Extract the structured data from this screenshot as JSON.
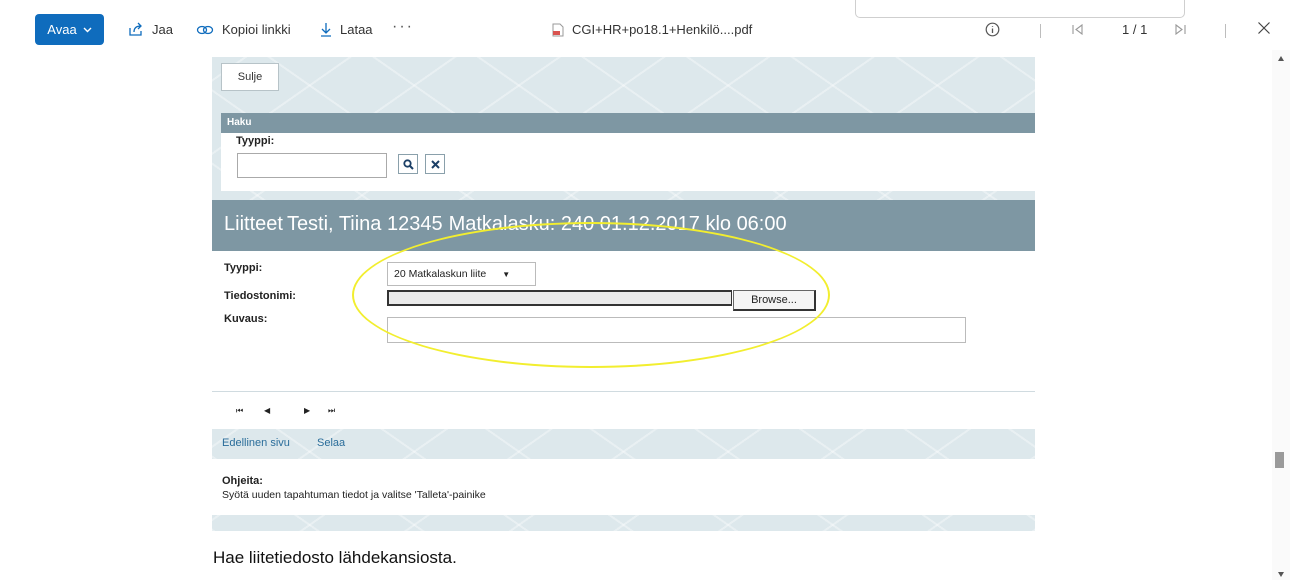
{
  "toolbar": {
    "open_label": "Avaa",
    "share_label": "Jaa",
    "copy_link_label": "Kopioi linkki",
    "download_label": "Lataa",
    "more_label": "···",
    "file_name": "CGI+HR+po18.1+Henkilö....pdf",
    "page_counter": "1 / 1",
    "icons": [
      "share-icon",
      "link-icon",
      "download-icon",
      "pdf-file-icon",
      "info-icon",
      "first-page-icon",
      "last-page-icon",
      "close-icon"
    ],
    "accent_color": "#0f6cbd"
  },
  "doc": {
    "close_button": "Sulje",
    "search": {
      "header": "Haku",
      "type_label": "Tyyppi:",
      "icons": [
        "search-icon",
        "clear-icon"
      ]
    },
    "attachments": {
      "title": "Liitteet",
      "person": "Testi, Tiina 12345",
      "invoice": "Matkalasku: 240 01.12.2017 klo 06:00",
      "type_label": "Tyyppi:",
      "type_value": "20 Matkalaskun liite",
      "file_label": "Tiedostonimi:",
      "browse_button": "Browse...",
      "desc_label": "Kuvaus:",
      "nav": {
        "first": "⏮",
        "prev": "◀",
        "next": "▶",
        "last": "⏭"
      }
    },
    "links": {
      "previous_page": "Edellinen sivu",
      "browse": "Selaa"
    },
    "help": {
      "title": "Ohjeita:",
      "text": "Syötä uuden tapahtuman tiedot ja valitse 'Talleta'-painike"
    },
    "header_color": "#7e97a3",
    "highlight_color": "#f2ee2f"
  },
  "caption": "Hae liitetiedosto lähdekansiosta."
}
